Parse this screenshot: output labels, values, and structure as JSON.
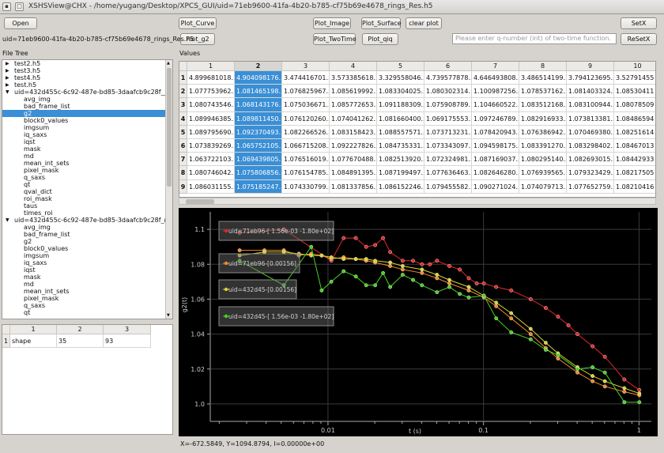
{
  "window": {
    "title": "XSHSView@CHX - /home/yugang/Desktop/XPCS_GUI/uid=71eb9600-41fa-4b20-b785-cf75b69e4678_rings_Res.h5"
  },
  "toolbar": {
    "open": "Open",
    "plot_curve": "Plot_Curve",
    "plot_g2": "Plot_g2",
    "plot_image": "Plot_Image",
    "plot_surface": "Plot_Surface",
    "clear_plot": "clear plot",
    "plot_twotime": "Plot_TwoTime",
    "plot_qiq": "Plot_qiq",
    "setx": "SetX",
    "resetx": "ReSetX",
    "q_input_placeholder": "Please enter q-number (int) of two-time function."
  },
  "file_label": "uid=71eb9600-41fa-4b20-b785-cf75b69e4678_rings_Res.h5",
  "file_tree_label": "File Tree",
  "values_label": "Values",
  "tree": [
    {
      "label": "test2.h5",
      "level": 0,
      "arrow": "right"
    },
    {
      "label": "test3.h5",
      "level": 0,
      "arrow": "right"
    },
    {
      "label": "test4.h5",
      "level": 0,
      "arrow": "right"
    },
    {
      "label": "test.h5",
      "level": 0,
      "arrow": "right"
    },
    {
      "label": "uid=432d455c-6c92-487e-bd85-3daafcb9c28f__Re...",
      "level": 0,
      "arrow": "down"
    },
    {
      "label": "avg_img",
      "level": 1
    },
    {
      "label": "bad_frame_list",
      "level": 1
    },
    {
      "label": "g2",
      "level": 1,
      "selected": true
    },
    {
      "label": "block0_values",
      "level": 1
    },
    {
      "label": "imgsum",
      "level": 1
    },
    {
      "label": "iq_saxs",
      "level": 1
    },
    {
      "label": "iqst",
      "level": 1
    },
    {
      "label": "mask",
      "level": 1
    },
    {
      "label": "md",
      "level": 1
    },
    {
      "label": "mean_int_sets",
      "level": 1
    },
    {
      "label": "pixel_mask",
      "level": 1
    },
    {
      "label": "q_saxs",
      "level": 1
    },
    {
      "label": "qt",
      "level": 1
    },
    {
      "label": "qval_dict",
      "level": 1
    },
    {
      "label": "roi_mask",
      "level": 1
    },
    {
      "label": "taus",
      "level": 1
    },
    {
      "label": "times_roi",
      "level": 1
    },
    {
      "label": "uid=432d455c-6c92-487e-bd85-3daafcb9c28f_ring...",
      "level": 0,
      "arrow": "down"
    },
    {
      "label": "avg_img",
      "level": 1
    },
    {
      "label": "bad_frame_list",
      "level": 1
    },
    {
      "label": "g2",
      "level": 1
    },
    {
      "label": "block0_values",
      "level": 1
    },
    {
      "label": "imgsum",
      "level": 1
    },
    {
      "label": "iq_saxs",
      "level": 1
    },
    {
      "label": "iqst",
      "level": 1
    },
    {
      "label": "mask",
      "level": 1
    },
    {
      "label": "md",
      "level": 1
    },
    {
      "label": "mean_int_sets",
      "level": 1
    },
    {
      "label": "pixel_mask",
      "level": 1
    },
    {
      "label": "q_saxs",
      "level": 1
    },
    {
      "label": "qt",
      "level": 1
    }
  ],
  "attr_table": {
    "headers": [
      "1",
      "2",
      "3"
    ],
    "rows": [
      {
        "row_label": "1",
        "cells": [
          "shape",
          "35",
          "93"
        ]
      }
    ]
  },
  "values_table": {
    "headers": [
      "1",
      "2",
      "3",
      "4",
      "5",
      "6",
      "7",
      "8",
      "9",
      "10"
    ],
    "selected_column": 1,
    "rows": [
      {
        "row_label": "1",
        "cells": [
          "4.899681018...",
          "4.904098176...",
          "3.474416701...",
          "3.573385618...",
          "3.329558046...",
          "4.739577878...",
          "4.646493808...",
          "3.486514199...",
          "3.794123695...",
          "3.52791455"
        ]
      },
      {
        "row_label": "2",
        "cells": [
          "1.077753962...",
          "1.081465198...",
          "1.076825967...",
          "1.085619992...",
          "1.083304025...",
          "1.080302314...",
          "1.100987256...",
          "1.078537162...",
          "1.081403324...",
          "1.08530411"
        ]
      },
      {
        "row_label": "3",
        "cells": [
          "1.080743546...",
          "1.068143176...",
          "1.075036671...",
          "1.085772653...",
          "1.091188309...",
          "1.075908789...",
          "1.104660522...",
          "1.083512168...",
          "1.083100944...",
          "1.08078509"
        ]
      },
      {
        "row_label": "4",
        "cells": [
          "1.089946385...",
          "1.089811450...",
          "1.076120260...",
          "1.074041262...",
          "1.081660400...",
          "1.069175553...",
          "1.097246789...",
          "1.082916933...",
          "1.073813381...",
          "1.08486594"
        ]
      },
      {
        "row_label": "5",
        "cells": [
          "1.089795690...",
          "1.092370493...",
          "1.082266526...",
          "1.083158423...",
          "1.088557571...",
          "1.073713231...",
          "1.078420943...",
          "1.076386942...",
          "1.070469380...",
          "1.08251614"
        ]
      },
      {
        "row_label": "6",
        "cells": [
          "1.073839269...",
          "1.065752105...",
          "1.066715208...",
          "1.092227826...",
          "1.084735331...",
          "1.073343097...",
          "1.094598175...",
          "1.083391270...",
          "1.083298402...",
          "1.08467013"
        ]
      },
      {
        "row_label": "7",
        "cells": [
          "1.063722103...",
          "1.069439805...",
          "1.076516019...",
          "1.077670488...",
          "1.082513920...",
          "1.072324981...",
          "1.087169037...",
          "1.080295140...",
          "1.082693015...",
          "1.08442933"
        ]
      },
      {
        "row_label": "8",
        "cells": [
          "1.080746042...",
          "1.075806856...",
          "1.076154785...",
          "1.084891395...",
          "1.087199497...",
          "1.077636463...",
          "1.082646280...",
          "1.076939565...",
          "1.079323429...",
          "1.08217505"
        ]
      },
      {
        "row_label": "9",
        "cells": [
          "1.086031155...",
          "1.075185247...",
          "1.074330799...",
          "1.081337856...",
          "1.086152246...",
          "1.079455582...",
          "1.090271024...",
          "1.074079713...",
          "1.077652759...",
          "1.08210416"
        ]
      }
    ]
  },
  "chart_data": {
    "type": "line",
    "xscale": "log",
    "xlabel": "t (s)",
    "ylabel": "g2(t)",
    "xlim": [
      0.00175,
      1.2
    ],
    "ylim": [
      0.99,
      1.11
    ],
    "xticks": [
      {
        "v": 0.01,
        "label": "0.01"
      },
      {
        "v": 0.1,
        "label": "0.1"
      },
      {
        "v": 1,
        "label": "1"
      }
    ],
    "yticks": [
      {
        "v": 1.0,
        "label": "1.0"
      },
      {
        "v": 1.02,
        "label": "1.02"
      },
      {
        "v": 1.04,
        "label": "1.04"
      },
      {
        "v": 1.06,
        "label": "1.06"
      },
      {
        "v": 1.08,
        "label": "1.08"
      },
      {
        "v": 1.1,
        "label": "1.1"
      }
    ],
    "series": [
      {
        "name": "uid=71eb96-[ 1.56e-03 -1.80e+02]",
        "color": "#e0282a",
        "x": [
          0.0027,
          0.0052,
          0.0105,
          0.0126,
          0.0151,
          0.0176,
          0.0201,
          0.0226,
          0.0251,
          0.0302,
          0.0352,
          0.0402,
          0.0452,
          0.0502,
          0.0603,
          0.0703,
          0.0804,
          0.0904,
          0.1005,
          0.1206,
          0.1507,
          0.2009,
          0.2512,
          0.3014,
          0.3516,
          0.4019,
          0.5023,
          0.6028,
          0.8038,
          1.0047
        ],
        "y": [
          1.098,
          1.1,
          1.082,
          1.095,
          1.095,
          1.09,
          1.091,
          1.095,
          1.087,
          1.082,
          1.082,
          1.08,
          1.08,
          1.082,
          1.079,
          1.077,
          1.072,
          1.069,
          1.069,
          1.067,
          1.065,
          1.06,
          1.055,
          1.05,
          1.045,
          1.04,
          1.033,
          1.027,
          1.014,
          1.008
        ]
      },
      {
        "name": "uid=71eb96-[0.00156]",
        "color": "#f08a2a",
        "x": [
          0.0027,
          0.0039,
          0.0052,
          0.0065,
          0.0078,
          0.0091,
          0.0105,
          0.0126,
          0.0151,
          0.0176,
          0.0201,
          0.0251,
          0.0302,
          0.0402,
          0.0502,
          0.0603,
          0.0804,
          0.1005,
          0.1206,
          0.1507,
          0.2009,
          0.2512,
          0.3014,
          0.4019,
          0.5023,
          0.6028,
          0.8038,
          1.0047
        ],
        "y": [
          1.088,
          1.088,
          1.088,
          1.085,
          1.086,
          1.085,
          1.083,
          1.084,
          1.083,
          1.082,
          1.081,
          1.079,
          1.077,
          1.075,
          1.072,
          1.069,
          1.065,
          1.061,
          1.056,
          1.049,
          1.04,
          1.032,
          1.026,
          1.018,
          1.013,
          1.01,
          1.007,
          1.005
        ]
      },
      {
        "name": "uid=432d45-[0.00156]",
        "color": "#d8d430",
        "x": [
          0.0027,
          0.0039,
          0.0052,
          0.0065,
          0.0078,
          0.0091,
          0.0105,
          0.0126,
          0.0151,
          0.0176,
          0.0201,
          0.0251,
          0.0302,
          0.0402,
          0.0502,
          0.0603,
          0.0804,
          0.1005,
          0.1206,
          0.1507,
          0.2009,
          0.2512,
          0.3014,
          0.4019,
          0.5023,
          0.6028,
          0.8038,
          1.0047
        ],
        "y": [
          1.085,
          1.087,
          1.087,
          1.086,
          1.085,
          1.085,
          1.084,
          1.083,
          1.083,
          1.083,
          1.082,
          1.081,
          1.079,
          1.077,
          1.074,
          1.071,
          1.067,
          1.062,
          1.058,
          1.052,
          1.043,
          1.035,
          1.029,
          1.021,
          1.016,
          1.013,
          1.009,
          1.006
        ]
      },
      {
        "name": "uid=432d45-[ 1.56e-03 -1.80e+02]",
        "color": "#48d022",
        "x": [
          0.0027,
          0.0052,
          0.0078,
          0.0091,
          0.0105,
          0.0126,
          0.0151,
          0.0176,
          0.0201,
          0.0226,
          0.0251,
          0.0302,
          0.0352,
          0.0402,
          0.0502,
          0.0603,
          0.0703,
          0.0804,
          0.1005,
          0.1206,
          0.1507,
          0.2009,
          0.2512,
          0.3014,
          0.4019,
          0.5023,
          0.6028,
          0.8038,
          1.0047
        ],
        "y": [
          1.082,
          1.068,
          1.09,
          1.065,
          1.07,
          1.076,
          1.073,
          1.068,
          1.068,
          1.075,
          1.067,
          1.074,
          1.071,
          1.068,
          1.064,
          1.067,
          1.063,
          1.061,
          1.062,
          1.049,
          1.041,
          1.037,
          1.031,
          1.028,
          1.02,
          1.021,
          1.018,
          1.001,
          1.001
        ]
      }
    ]
  },
  "status_bar": "X=-672.5849, Y=1094.8794, I=0.00000e+00"
}
